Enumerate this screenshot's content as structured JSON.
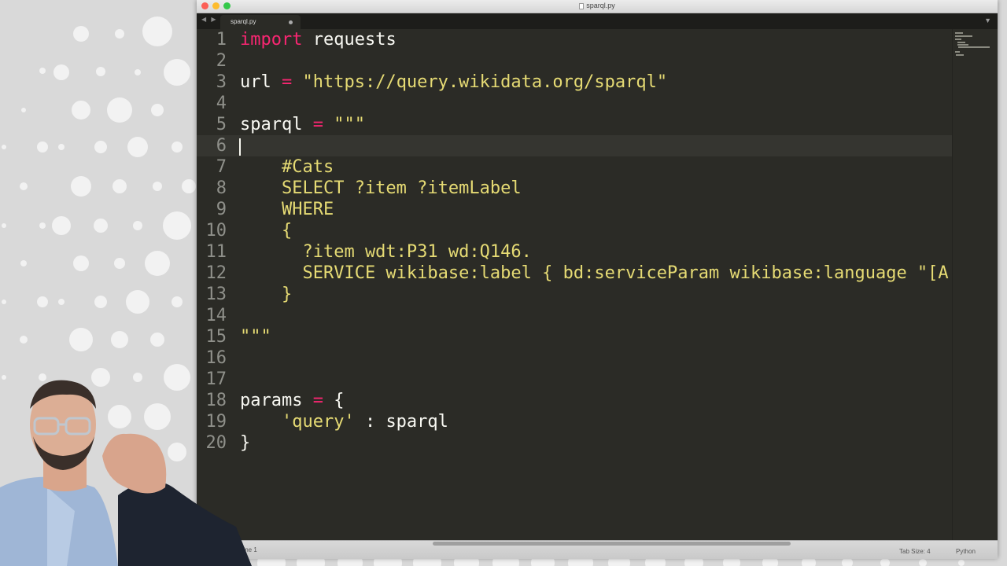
{
  "window": {
    "title": "sparql.py",
    "tab_label": "sparql.py",
    "nav_arrows": "◀ ▶",
    "tab_menu": "▼"
  },
  "editor": {
    "lines": [
      {
        "n": "1",
        "parts": [
          [
            "kw",
            "import"
          ],
          [
            "txt",
            " requests"
          ]
        ]
      },
      {
        "n": "2",
        "parts": []
      },
      {
        "n": "3",
        "parts": [
          [
            "txt",
            "url "
          ],
          [
            "op",
            "="
          ],
          [
            "txt",
            " "
          ],
          [
            "str",
            "\"https://query.wikidata.org/sparql\""
          ]
        ]
      },
      {
        "n": "4",
        "parts": []
      },
      {
        "n": "5",
        "parts": [
          [
            "txt",
            "sparql "
          ],
          [
            "op",
            "="
          ],
          [
            "txt",
            " "
          ],
          [
            "str",
            "\"\"\""
          ]
        ]
      },
      {
        "n": "6",
        "parts": []
      },
      {
        "n": "7",
        "parts": [
          [
            "str",
            "    #Cats"
          ]
        ]
      },
      {
        "n": "8",
        "parts": [
          [
            "str",
            "    SELECT ?item ?itemLabel"
          ]
        ]
      },
      {
        "n": "9",
        "parts": [
          [
            "str",
            "    WHERE"
          ]
        ]
      },
      {
        "n": "10",
        "parts": [
          [
            "str",
            "    {"
          ]
        ]
      },
      {
        "n": "11",
        "parts": [
          [
            "str",
            "      ?item wdt:P31 wd:Q146."
          ]
        ]
      },
      {
        "n": "12",
        "parts": [
          [
            "str",
            "      SERVICE wikibase:label { bd:serviceParam wikibase:language \"[A"
          ]
        ]
      },
      {
        "n": "13",
        "parts": [
          [
            "str",
            "    }"
          ]
        ]
      },
      {
        "n": "14",
        "parts": []
      },
      {
        "n": "15",
        "parts": [
          [
            "str",
            "\"\"\""
          ]
        ]
      },
      {
        "n": "16",
        "parts": []
      },
      {
        "n": "17",
        "parts": []
      },
      {
        "n": "18",
        "parts": [
          [
            "txt",
            "params "
          ],
          [
            "op",
            "="
          ],
          [
            "txt",
            " {"
          ]
        ]
      },
      {
        "n": "19",
        "parts": [
          [
            "txt",
            "    "
          ],
          [
            "str",
            "'query'"
          ],
          [
            "txt",
            " : sparql"
          ]
        ]
      },
      {
        "n": "20",
        "parts": [
          [
            "txt",
            "}"
          ]
        ]
      }
    ],
    "cursor_line": "6"
  },
  "statusbar": {
    "position": "Line 1",
    "tab_size": "Tab Size: 4",
    "syntax": "Python"
  },
  "colors": {
    "editor_bg": "#2b2b26",
    "keyword": "#f92672",
    "string": "#e6db74",
    "text": "#f8f8f2",
    "line_number": "#8f908a"
  }
}
